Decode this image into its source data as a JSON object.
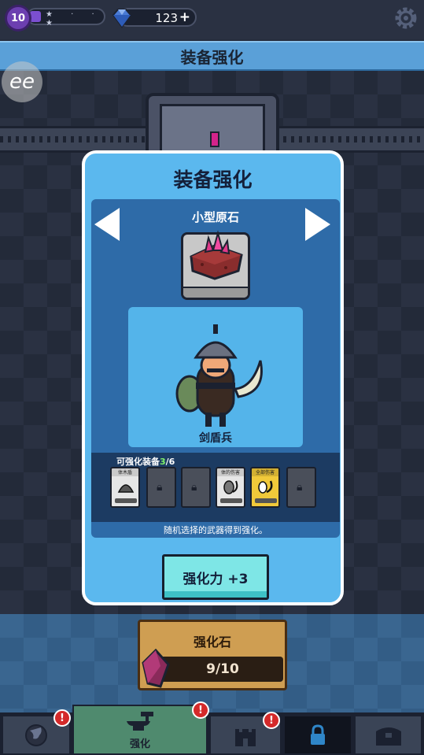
{
  "top_bar": {
    "level": "10",
    "xp_stars": "★ · · ★",
    "gems": "123",
    "gem_plus": "+"
  },
  "header": {
    "title": "装备强化",
    "overlay_button": "ee"
  },
  "dialog": {
    "title": "装备强化",
    "stone_name": "小型原石",
    "character_name": "剑盾兵",
    "equip_label_prefix": "可强化装备",
    "equip_count": "3",
    "equip_total": "/6",
    "slots": [
      {
        "state": "white",
        "top": "体木盾"
      },
      {
        "state": "locked"
      },
      {
        "state": "locked"
      },
      {
        "state": "white",
        "top": "体的伤害"
      },
      {
        "state": "gold",
        "top": "全部伤害"
      },
      {
        "state": "locked"
      }
    ],
    "note": "随机选择的武器得到强化。",
    "power_button": "强化力 +3"
  },
  "stone_panel": {
    "title": "强化石",
    "count": "9/10"
  },
  "nav": {
    "forge_label": "强化",
    "badge": "!"
  },
  "colors": {
    "dialog_bg": "#5bb8ee",
    "panel_bg": "#2e6ba8",
    "button_cyan": "#7ee6e6",
    "badge_red": "#d42a2a",
    "highlight_green": "#7ff06a"
  }
}
